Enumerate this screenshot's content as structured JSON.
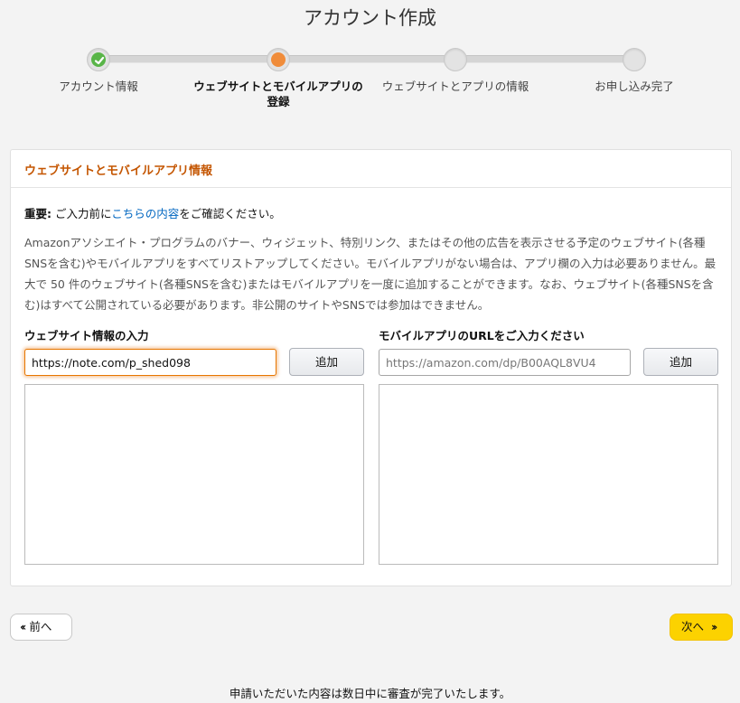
{
  "page": {
    "title": "アカウント作成"
  },
  "steps": [
    {
      "label": "アカウント情報",
      "state": "done"
    },
    {
      "label_line1": "ウェブサイトとモバイルアプリの",
      "label_line2": "登録",
      "state": "current"
    },
    {
      "label": "ウェブサイトとアプリの情報",
      "state": "pending"
    },
    {
      "label": "お申し込み完了",
      "state": "pending"
    }
  ],
  "panel": {
    "title": "ウェブサイトとモバイルアプリ情報",
    "notice": {
      "bold": "重要:",
      "before_link": " ご入力前に",
      "link": "こちらの内容",
      "after_link": "をご確認ください。"
    },
    "description": "Amazonアソシエイト・プログラムのバナー、ウィジェット、特別リンク、またはその他の広告を表示させる予定のウェブサイト(各種SNSを含む)やモバイルアプリをすべてリストアップしてください。モバイルアプリがない場合は、アプリ欄の入力は必要ありません。最大で 50 件のウェブサイト(各種SNSを含む)またはモバイルアプリを一度に追加することができます。なお、ウェブサイト(各種SNSを含む)はすべて公開されている必要があります。非公開のサイトやSNSでは参加はできません。",
    "website": {
      "label": "ウェブサイト情報の入力",
      "value": "https://note.com/p_shed098",
      "add_label": "追加"
    },
    "app": {
      "label": "モバイルアプリのURLをご入力ください",
      "placeholder": "https://amazon.com/dp/B00AQL8VU4",
      "add_label": "追加"
    }
  },
  "nav": {
    "prev_label": "前へ",
    "next_label": "次へ"
  },
  "footer": {
    "note": "申請いただいた内容は数日中に審査が完了いたします。"
  },
  "colors": {
    "accent_orange": "#c45500",
    "done_green": "#59b548",
    "current_orange": "#f08c3a",
    "next_yellow": "#fcd200",
    "link_blue": "#0066c0"
  }
}
